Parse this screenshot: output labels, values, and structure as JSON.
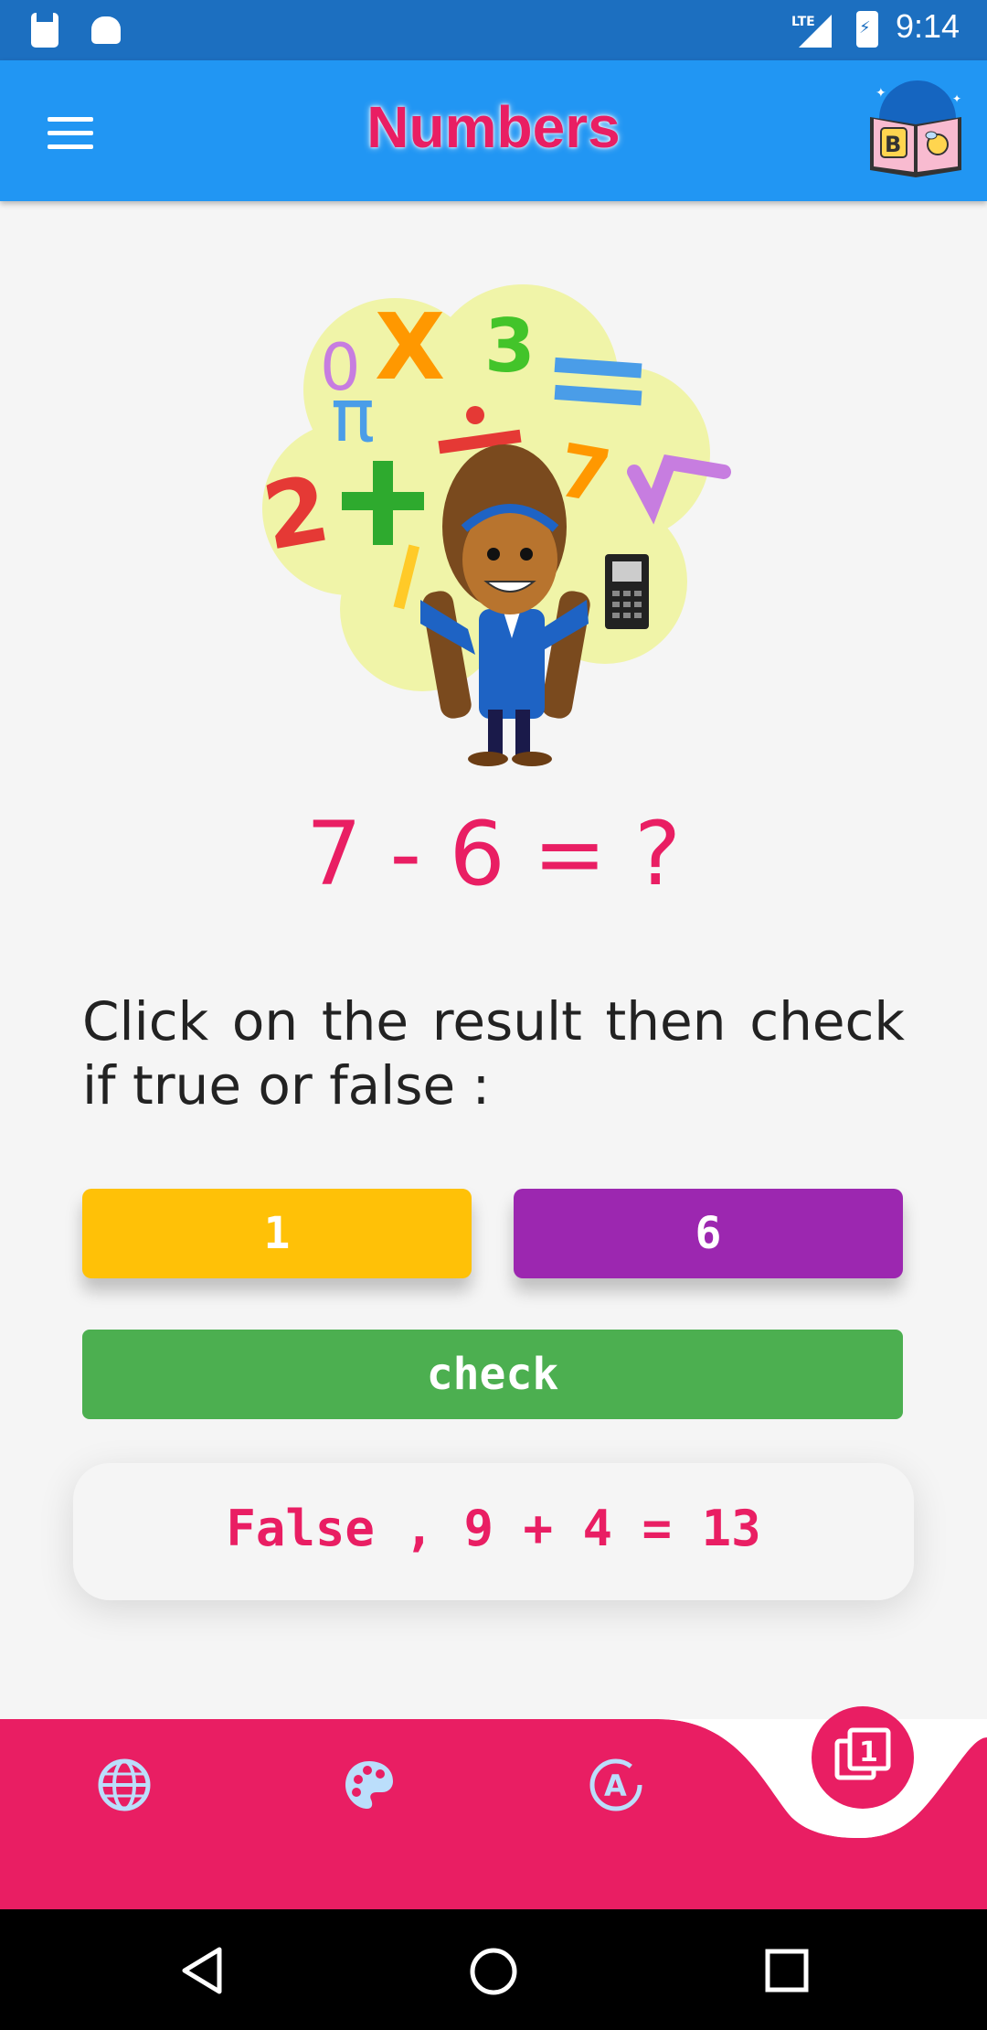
{
  "status_bar": {
    "network": "LTE",
    "time": "9:14"
  },
  "app_bar": {
    "title": "Numbers"
  },
  "exercise": {
    "equation": "7 - 6 = ?",
    "instruction": "Click on the result then check if true or false :",
    "answers": [
      "1",
      "6"
    ],
    "check_label": "check",
    "result_text": "False , 9 + 4 = 13"
  },
  "illustration": {
    "symbols": [
      "0",
      "X",
      "3",
      "=",
      "π",
      "÷",
      "7",
      "√",
      "2",
      "+"
    ]
  },
  "bottom_nav": {
    "items": [
      "globe-icon",
      "palette-icon",
      "alphabet-icon",
      "numbers-icon"
    ],
    "fab_label": "1"
  },
  "colors": {
    "primary": "#2196f3",
    "accent": "#e91e63",
    "answer1": "#ffc107",
    "answer2": "#9c27b0",
    "check": "#4caf50"
  }
}
